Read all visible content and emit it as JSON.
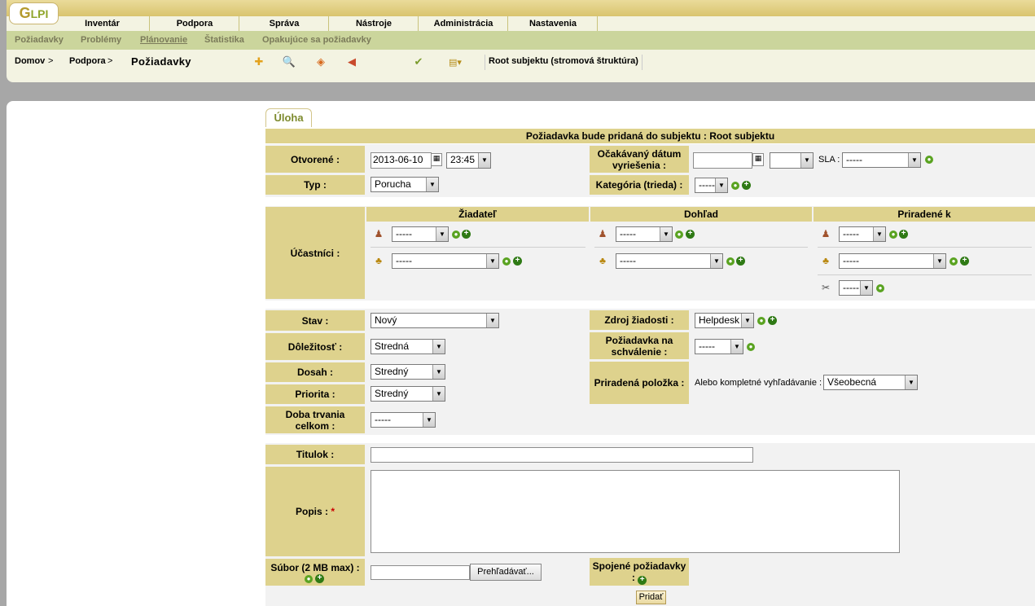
{
  "logo": {
    "text": "LPI",
    "mark": "G"
  },
  "main_menu": [
    "Inventár",
    "Podpora",
    "Správa",
    "Nástroje",
    "Administrácia",
    "Nastavenia"
  ],
  "sub_menu": [
    "Požiadavky",
    "Problémy",
    "Plánovanie",
    "Štatistika",
    "Opakujúce sa požiadavky"
  ],
  "breadcrumb": {
    "home": "Domov",
    "sep": ">",
    "section": "Podpora",
    "current": "Požiadavky"
  },
  "entity": "Root subjektu (stromová štruktúra)",
  "tab": "Úloha",
  "form": {
    "header": "Požiadavka bude pridaná do subjektu : Root subjektu",
    "opened_label": "Otvorené :",
    "opened_date": "2013-06-10",
    "opened_time": "23:45",
    "due_label": "Očakávaný dátum vyriešenia :",
    "sla_label": "SLA :",
    "sla_value": "-----",
    "type_label": "Typ :",
    "type_value": "Porucha",
    "category_label": "Kategória (trieda) :",
    "category_value": "-----",
    "participants_label": "Účastníci :",
    "col_requester": "Žiadateľ",
    "col_observer": "Dohľad",
    "col_assigned": "Priradené k",
    "dash": "-----",
    "status_label": "Stav :",
    "status_value": "Nový",
    "urgency_label": "Dôležitosť :",
    "urgency_value": "Stredná",
    "impact_label": "Dosah :",
    "impact_value": "Stredný",
    "priority_label": "Priorita :",
    "priority_value": "Stredný",
    "duration_label": "Doba trvania celkom :",
    "duration_value": "-----",
    "source_label": "Zdroj žiadosti :",
    "source_value": "Helpdesk",
    "validation_label": "Požiadavka na schválenie :",
    "validation_value": "-----",
    "item_label": "Priradená položka :",
    "item_search_label": "Alebo kompletné vyhľadávanie :",
    "item_search_value": "Všeobecná",
    "title_label": "Titulok :",
    "desc_label": "Popis :",
    "required_mark": "*",
    "file_label": "Súbor (2 MB max) :",
    "browse": "Prehľadávať...",
    "linked_label": "Spojené požiadavky :",
    "submit": "Pridať"
  }
}
